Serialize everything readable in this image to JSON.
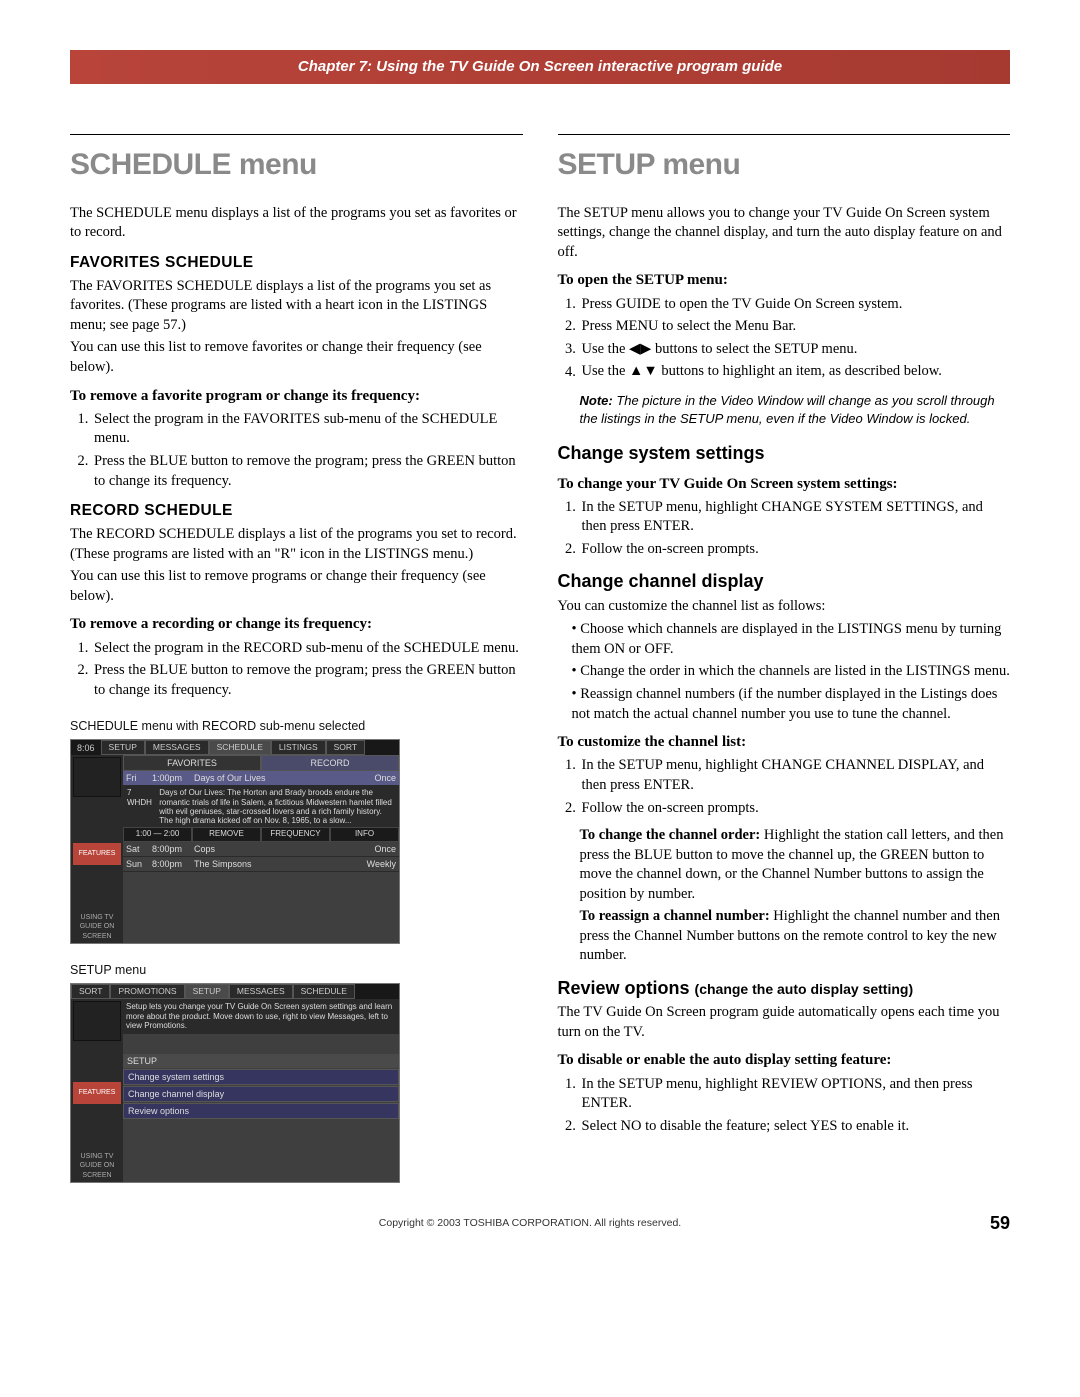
{
  "header": "Chapter 7: Using the TV Guide On Screen interactive program guide",
  "left": {
    "title": "SCHEDULE menu",
    "intro": "The SCHEDULE menu displays a list of the programs you set as favorites or to record.",
    "fav": {
      "heading": "FAVORITES SCHEDULE",
      "p1": "The FAVORITES SCHEDULE displays a list of the programs you set as favorites. (These programs are listed with a heart icon in the LISTINGS menu; see page 57.)",
      "p2": "You can use this list to remove favorites or change their frequency (see below).",
      "lead": "To remove a favorite program or change its frequency:",
      "li1": "Select the program in the FAVORITES sub-menu of the SCHEDULE menu.",
      "li2": "Press the BLUE button to remove the program; press the GREEN button to change its frequency."
    },
    "rec": {
      "heading": "RECORD SCHEDULE",
      "p1": "The RECORD SCHEDULE displays a list of the programs you set to record. (These programs are listed with an \"R\" icon in the LISTINGS menu.)",
      "p2": "You can use this list to remove programs or change their frequency (see below).",
      "lead": "To remove a recording or change its frequency:",
      "li1": "Select the program in the RECORD sub-menu of the SCHEDULE menu.",
      "li2": "Press the BLUE button to remove the program; press the GREEN button to change its frequency."
    },
    "cap1": "SCHEDULE menu with RECORD sub-menu selected",
    "cap2": "SETUP menu",
    "ss1": {
      "time": "8:06",
      "tabs": [
        "SETUP",
        "MESSAGES",
        "SCHEDULE",
        "LISTINGS",
        "SORT"
      ],
      "subtabs": [
        "FAVORITES",
        "RECORD"
      ],
      "rows": [
        {
          "day": "Fri",
          "time": "1:00pm",
          "title": "Days of Our Lives",
          "freq": "Once"
        },
        {
          "day": "Sat",
          "time": "8:00pm",
          "title": "Cops",
          "freq": "Once"
        },
        {
          "day": "Sun",
          "time": "8:00pm",
          "title": "The Simpsons",
          "freq": "Weekly"
        }
      ],
      "ch": "7 WHDH",
      "desc": "Days of Our Lives: The Horton and Brady broods endure the romantic trials of life in Salem, a fictitious Midwestern hamlet filled with evil geniuses, star-crossed lovers and a rich family history. The high drama kicked off on Nov. 8, 1965, to a slow...",
      "tl": "1:00 — 2:00",
      "btns": [
        "REMOVE",
        "FREQUENCY",
        "INFO"
      ],
      "side": "FEATURES",
      "side2": "USING TV GUIDE ON SCREEN"
    },
    "ss2": {
      "tabs": [
        "SORT",
        "PROMOTIONS",
        "SETUP",
        "MESSAGES",
        "SCHEDULE"
      ],
      "msg": "Setup lets you change your TV Guide On Screen system settings and learn more about the product. Move down to use, right to view Messages, left to view Promotions.",
      "head": "SETUP",
      "items": [
        "Change system settings",
        "Change channel display",
        "Review options"
      ],
      "side": "FEATURES",
      "side2": "USING TV GUIDE ON SCREEN"
    }
  },
  "right": {
    "title": "SETUP menu",
    "intro": "The SETUP menu allows you to change your TV Guide On Screen system settings, change the channel display, and turn the auto display feature on and off.",
    "open": {
      "lead": "To open the SETUP menu:",
      "li1": "Press GUIDE to open the TV Guide On Screen system.",
      "li2": "Press MENU to select the Menu Bar.",
      "li3a": "Use the ",
      "li3b": " buttons to select the SETUP menu.",
      "li4a": "Use the ",
      "li4b": " buttons to highlight an item, as described below."
    },
    "note": {
      "label": "Note:",
      "text": " The picture in the Video Window will change as you scroll through the listings in the SETUP menu, even if the Video Window is locked."
    },
    "css": {
      "heading": "Change system settings",
      "lead": "To change your TV Guide On Screen system settings:",
      "li1": "In the SETUP menu, highlight CHANGE SYSTEM SETTINGS, and then press ENTER.",
      "li2": "Follow the on-screen prompts."
    },
    "ccd": {
      "heading": "Change channel display",
      "intro": "You can customize the channel list as follows:",
      "b1": "Choose which channels are displayed in the LISTINGS menu by turning them ON or OFF.",
      "b2": "Change the order in which the channels are listed in the LISTINGS menu.",
      "b3": "Reassign channel numbers (if the number displayed in the Listings does not match the actual channel number you use to tune the channel.",
      "lead": "To customize the channel list:",
      "li1": "In the SETUP menu, highlight CHANGE CHANNEL DISPLAY, and then press ENTER.",
      "li2": "Follow the on-screen prompts.",
      "order_label": "To change the channel order:",
      "order": " Highlight the station call letters, and then press the BLUE button to move the channel up, the GREEN button to move the channel down, or the Channel Number buttons to assign the position by number.",
      "reassign_label": "To reassign a channel number:",
      "reassign": " Highlight the channel number and then press the Channel Number buttons on the remote control to key the new number."
    },
    "rev": {
      "heading": "Review options",
      "heading_paren": "(change the auto display setting)",
      "intro": "The TV Guide On Screen program guide automatically opens each time you turn on the TV.",
      "lead": "To disable or enable the auto display setting feature:",
      "li1": "In the SETUP menu, highlight REVIEW OPTIONS, and then press ENTER.",
      "li2": "Select NO to disable the feature; select YES to enable it."
    }
  },
  "footer": {
    "copyright": "Copyright © 2003 TOSHIBA CORPORATION. All rights reserved.",
    "page": "59"
  }
}
